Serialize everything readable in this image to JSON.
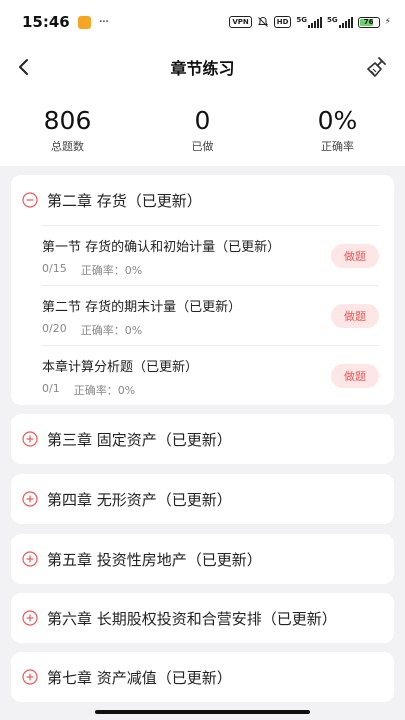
{
  "status_bar": {
    "time": "15:46",
    "more": "···",
    "vpn": "VPN",
    "hd": "HD",
    "net1": "5G",
    "net2": "5G",
    "battery": "76",
    "battery_level": 0.76
  },
  "header": {
    "title": "章节练习",
    "back_icon": "back-chevron-icon",
    "clean_icon": "broom-icon"
  },
  "stats": [
    {
      "value": "806",
      "label": "总题数"
    },
    {
      "value": "0",
      "label": "已做"
    },
    {
      "value": "0%",
      "label": "正确率"
    }
  ],
  "chapters": [
    {
      "title": "第二章 存货（已更新）",
      "expanded": true,
      "sections": [
        {
          "title": "第一节 存货的确认和初始计量（已更新）",
          "progress": "0/15",
          "accuracy": "正确率：0%",
          "action": "做题"
        },
        {
          "title": "第二节 存货的期末计量（已更新）",
          "progress": "0/20",
          "accuracy": "正确率：0%",
          "action": "做题"
        },
        {
          "title": "本章计算分析题（已更新）",
          "progress": "0/1",
          "accuracy": "正确率：0%",
          "action": "做题"
        }
      ]
    },
    {
      "title": "第三章 固定资产（已更新）",
      "expanded": false
    },
    {
      "title": "第四章 无形资产（已更新）",
      "expanded": false
    },
    {
      "title": "第五章 投资性房地产（已更新）",
      "expanded": false
    },
    {
      "title": "第六章 长期股权投资和合营安排（已更新）",
      "expanded": false
    },
    {
      "title": "第七章 资产减值（已更新）",
      "expanded": false
    }
  ],
  "colors": {
    "accent": "#e85a5a",
    "button_bg": "#fde6e6",
    "page_bg": "#f2f2f4"
  }
}
